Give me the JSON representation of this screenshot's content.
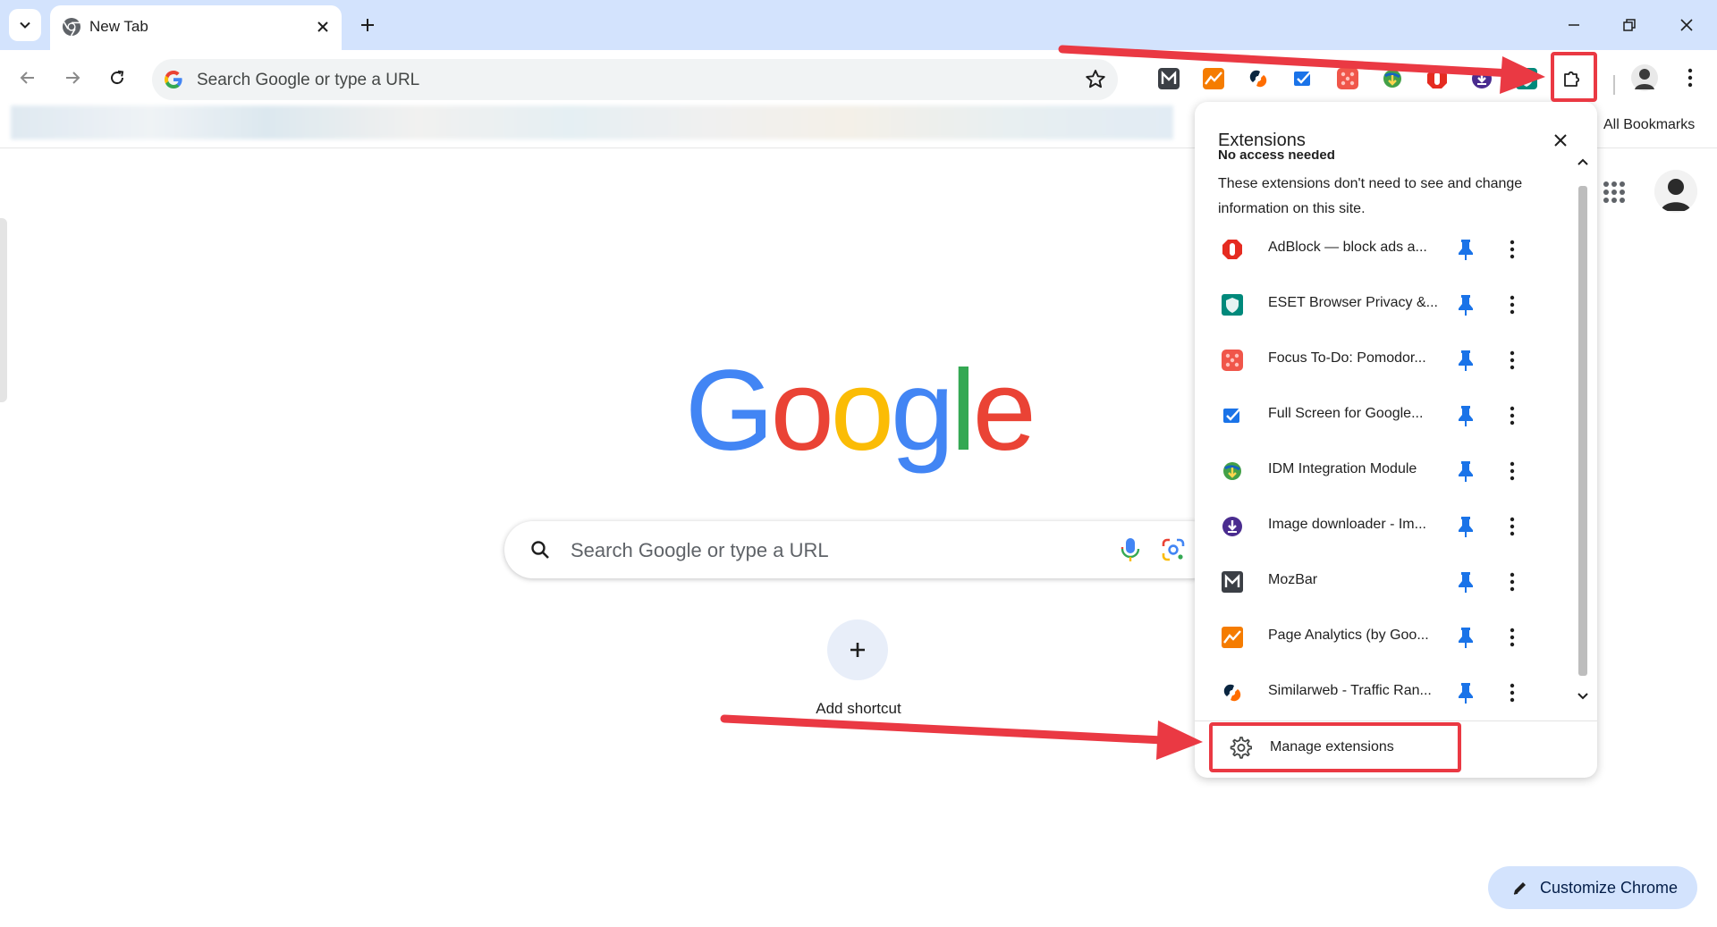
{
  "tab": {
    "title": "New Tab"
  },
  "omnibox": {
    "placeholder": "Search Google or type a URL"
  },
  "bookmarks": {
    "all_label": "All Bookmarks"
  },
  "ntp": {
    "logo_letters": [
      "G",
      "o",
      "o",
      "g",
      "l",
      "e"
    ],
    "logo_colors": [
      "#4285f4",
      "#ea4335",
      "#fbbc05",
      "#4285f4",
      "#34a853",
      "#ea4335"
    ],
    "search_placeholder": "Search Google or type a URL",
    "add_shortcut": "Add shortcut",
    "customize": "Customize Chrome"
  },
  "extensions": {
    "title": "Extensions",
    "section_heading": "No access needed",
    "section_desc": "These extensions don't need to see and change information on this site.",
    "items": [
      {
        "name": "AdBlock — block ads a...",
        "icon": "adblock-icon"
      },
      {
        "name": "ESET Browser Privacy &...",
        "icon": "eset-icon"
      },
      {
        "name": "Focus To-Do: Pomodor...",
        "icon": "focus-todo-icon"
      },
      {
        "name": "Full Screen for Google...",
        "icon": "full-screen-icon"
      },
      {
        "name": "IDM Integration Module",
        "icon": "idm-icon"
      },
      {
        "name": "Image downloader - Im...",
        "icon": "image-downloader-icon"
      },
      {
        "name": "MozBar",
        "icon": "mozbar-icon"
      },
      {
        "name": "Page Analytics (by Goo...",
        "icon": "page-analytics-icon"
      },
      {
        "name": "Similarweb - Traffic Ran...",
        "icon": "similarweb-icon"
      }
    ],
    "manage_label": "Manage extensions"
  },
  "colors": {
    "accent": "#0b57d0",
    "pin": "#1a73e8",
    "highlight": "#ea3943",
    "tabstrip": "#d3e3fd"
  }
}
